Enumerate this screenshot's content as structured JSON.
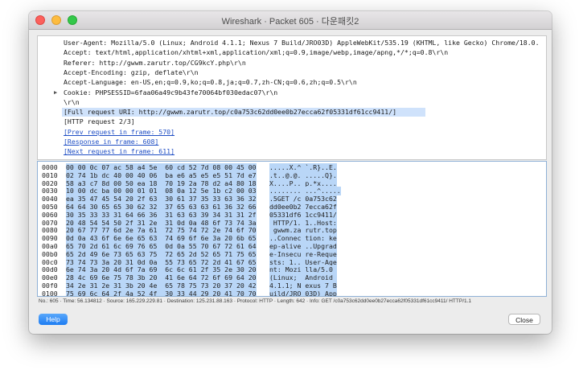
{
  "window": {
    "title": "Wireshark · Packet 605 · 다운패킷2"
  },
  "details": {
    "lines": [
      {
        "text": "User-Agent: Mozilla/5.0 (Linux; Android 4.1.1; Nexus 7 Build/JRO03D) AppleWebKit/535.19 (KHTML, like Gecko) Chrome/18.0.",
        "kind": "plain"
      },
      {
        "text": "Accept: text/html,application/xhtml+xml,application/xml;q=0.9,image/webp,image/apng,*/*;q=0.8\\r\\n",
        "kind": "plain"
      },
      {
        "text": "Referer: http://gwwm.zarutr.top/CG9kcY.php\\r\\n",
        "kind": "plain"
      },
      {
        "text": "Accept-Encoding: gzip, deflate\\r\\n",
        "kind": "plain"
      },
      {
        "text": "Accept-Language: en-US,en;q=0.9,ko;q=0.8,ja;q=0.7,zh-CN;q=0.6,zh;q=0.5\\r\\n",
        "kind": "plain"
      },
      {
        "text": "Cookie: PHPSESSID=6faa06a49c9b43fe70064bf030edac07\\r\\n",
        "kind": "plain",
        "twisty": "▶"
      },
      {
        "text": "\\r\\n",
        "kind": "plain"
      },
      {
        "text": "[Full request URI: http://gwwm.zarutr.top/c0a753c62dd0ee0b27ecca62f05331df61cc9411/]",
        "kind": "selected"
      },
      {
        "text": "[HTTP request 2/3]",
        "kind": "plain"
      },
      {
        "text": "[Prev request in frame: 570]",
        "kind": "link"
      },
      {
        "text": "[Response in frame: 608]",
        "kind": "link"
      },
      {
        "text": "[Next request in frame: 611]",
        "kind": "link"
      }
    ]
  },
  "bytes": {
    "rows": [
      {
        "offset": "0000",
        "hex": "00 00 0c 07 ac 58 a4 5e  60 cd 52 7d 08 00 45 00",
        "ascii": ".....X.^ `.R}..E."
      },
      {
        "offset": "0010",
        "hex": "02 74 1b dc 40 00 40 06  ba e6 a5 e5 e5 51 7d e7",
        "ascii": ".t..@.@. .....Q}."
      },
      {
        "offset": "0020",
        "hex": "58 a3 c7 8d 00 50 ea 18  70 19 2a 78 d2 a4 80 18",
        "ascii": "X....P.. p.*x...."
      },
      {
        "offset": "0030",
        "hex": "10 00 dc ba 00 00 01 01  08 0a 12 5e 1b c2 00 03",
        "ascii": "........ ...^....."
      },
      {
        "offset": "0040",
        "hex": "ea 35 47 45 54 20 2f 63  30 61 37 35 33 63 36 32",
        "ascii": ".5GET /c 0a753c62"
      },
      {
        "offset": "0050",
        "hex": "64 64 30 65 65 30 62 32  37 65 63 63 61 36 32 66",
        "ascii": "dd0ee0b2 7ecca62f"
      },
      {
        "offset": "0060",
        "hex": "30 35 33 33 31 64 66 36  31 63 63 39 34 31 31 2f",
        "ascii": "05331df6 1cc9411/"
      },
      {
        "offset": "0070",
        "hex": "20 48 54 54 50 2f 31 2e  31 0d 0a 48 6f 73 74 3a",
        "ascii": " HTTP/1. 1..Host:"
      },
      {
        "offset": "0080",
        "hex": "20 67 77 77 6d 2e 7a 61  72 75 74 72 2e 74 6f 70",
        "ascii": " gwwm.za rutr.top"
      },
      {
        "offset": "0090",
        "hex": "0d 0a 43 6f 6e 6e 65 63  74 69 6f 6e 3a 20 6b 65",
        "ascii": "..Connec tion: ke"
      },
      {
        "offset": "00a0",
        "hex": "65 70 2d 61 6c 69 76 65  0d 0a 55 70 67 72 61 64",
        "ascii": "ep-alive ..Upgrad"
      },
      {
        "offset": "00b0",
        "hex": "65 2d 49 6e 73 65 63 75  72 65 2d 52 65 71 75 65",
        "ascii": "e-Insecu re-Reque"
      },
      {
        "offset": "00c0",
        "hex": "73 74 73 3a 20 31 0d 0a  55 73 65 72 2d 41 67 65",
        "ascii": "sts: 1.. User-Age"
      },
      {
        "offset": "00d0",
        "hex": "6e 74 3a 20 4d 6f 7a 69  6c 6c 61 2f 35 2e 30 20",
        "ascii": "nt: Mozi lla/5.0 "
      },
      {
        "offset": "00e0",
        "hex": "28 4c 69 6e 75 78 3b 20  41 6e 64 72 6f 69 64 20",
        "ascii": "(Linux;  Android "
      },
      {
        "offset": "00f0",
        "hex": "34 2e 31 2e 31 3b 20 4e  65 78 75 73 20 37 20 42",
        "ascii": "4.1.1; N exus 7 B"
      },
      {
        "offset": "0100",
        "hex": "75 69 6c 64 2f 4a 52 4f  30 33 44 29 20 41 70 70",
        "ascii": "uild/JRO 03D) App"
      }
    ]
  },
  "status": {
    "text": "No.: 605 · Time: 56.134812 · Source: 165.229.229.81 · Destination: 125.231.88.163 · Protocol: HTTP · Length: 642 · Info: GET /c0a753c62dd0ee0b27ecca62f05331df61cc9411/ HTTP/1.1"
  },
  "buttons": {
    "help": "Help",
    "close": "Close"
  },
  "colors": {
    "help_button": "#1d7cf2",
    "selection": "#cfe2fb",
    "byte_highlight": "#b9d6f7",
    "link": "#1f4ec4"
  }
}
